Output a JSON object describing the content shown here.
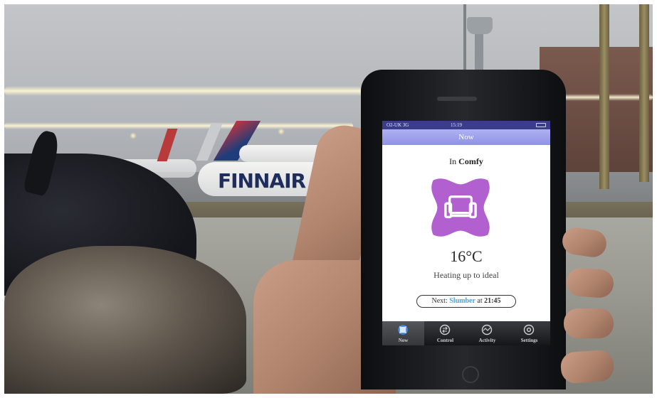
{
  "scene": {
    "airline_livery_text": "FINNAIR"
  },
  "phone": {
    "status_bar": {
      "carrier": "O2-UK 3G",
      "time": "15:19"
    },
    "nav_title": "Now",
    "mode_prefix": "In",
    "mode_name": "Comfy",
    "mode_badge_icon": "armchair-icon",
    "badge_color": "#b25fcf",
    "temperature": "16°C",
    "status_text": "Heating up to ideal",
    "next": {
      "label": "Next:",
      "mode": "Slumber",
      "at": "at",
      "time": "21:45",
      "mode_color": "#4aa3df"
    },
    "tabs": [
      {
        "label": "Now",
        "icon": "now-icon",
        "active": true
      },
      {
        "label": "Control",
        "icon": "control-icon",
        "active": false
      },
      {
        "label": "Activity",
        "icon": "activity-icon",
        "active": false
      },
      {
        "label": "Settings",
        "icon": "settings-icon",
        "active": false
      }
    ]
  }
}
